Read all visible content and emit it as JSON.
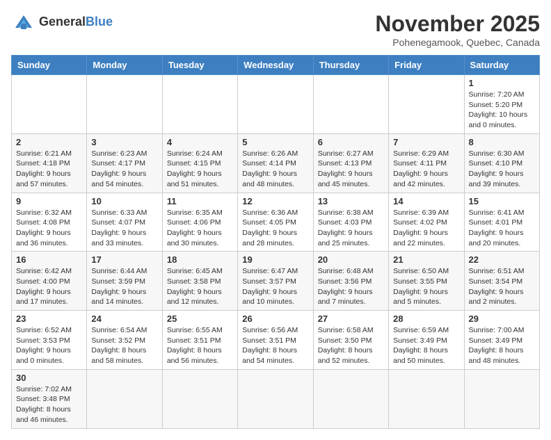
{
  "header": {
    "logo_text_normal": "General",
    "logo_text_bold": "Blue",
    "month_title": "November 2025",
    "location": "Pohenegamook, Quebec, Canada"
  },
  "days_of_week": [
    "Sunday",
    "Monday",
    "Tuesday",
    "Wednesday",
    "Thursday",
    "Friday",
    "Saturday"
  ],
  "weeks": [
    [
      {
        "day": "",
        "info": ""
      },
      {
        "day": "",
        "info": ""
      },
      {
        "day": "",
        "info": ""
      },
      {
        "day": "",
        "info": ""
      },
      {
        "day": "",
        "info": ""
      },
      {
        "day": "",
        "info": ""
      },
      {
        "day": "1",
        "info": "Sunrise: 7:20 AM\nSunset: 5:20 PM\nDaylight: 10 hours and 0 minutes."
      }
    ],
    [
      {
        "day": "2",
        "info": "Sunrise: 6:21 AM\nSunset: 4:18 PM\nDaylight: 9 hours and 57 minutes."
      },
      {
        "day": "3",
        "info": "Sunrise: 6:23 AM\nSunset: 4:17 PM\nDaylight: 9 hours and 54 minutes."
      },
      {
        "day": "4",
        "info": "Sunrise: 6:24 AM\nSunset: 4:15 PM\nDaylight: 9 hours and 51 minutes."
      },
      {
        "day": "5",
        "info": "Sunrise: 6:26 AM\nSunset: 4:14 PM\nDaylight: 9 hours and 48 minutes."
      },
      {
        "day": "6",
        "info": "Sunrise: 6:27 AM\nSunset: 4:13 PM\nDaylight: 9 hours and 45 minutes."
      },
      {
        "day": "7",
        "info": "Sunrise: 6:29 AM\nSunset: 4:11 PM\nDaylight: 9 hours and 42 minutes."
      },
      {
        "day": "8",
        "info": "Sunrise: 6:30 AM\nSunset: 4:10 PM\nDaylight: 9 hours and 39 minutes."
      }
    ],
    [
      {
        "day": "9",
        "info": "Sunrise: 6:32 AM\nSunset: 4:08 PM\nDaylight: 9 hours and 36 minutes."
      },
      {
        "day": "10",
        "info": "Sunrise: 6:33 AM\nSunset: 4:07 PM\nDaylight: 9 hours and 33 minutes."
      },
      {
        "day": "11",
        "info": "Sunrise: 6:35 AM\nSunset: 4:06 PM\nDaylight: 9 hours and 30 minutes."
      },
      {
        "day": "12",
        "info": "Sunrise: 6:36 AM\nSunset: 4:05 PM\nDaylight: 9 hours and 28 minutes."
      },
      {
        "day": "13",
        "info": "Sunrise: 6:38 AM\nSunset: 4:03 PM\nDaylight: 9 hours and 25 minutes."
      },
      {
        "day": "14",
        "info": "Sunrise: 6:39 AM\nSunset: 4:02 PM\nDaylight: 9 hours and 22 minutes."
      },
      {
        "day": "15",
        "info": "Sunrise: 6:41 AM\nSunset: 4:01 PM\nDaylight: 9 hours and 20 minutes."
      }
    ],
    [
      {
        "day": "16",
        "info": "Sunrise: 6:42 AM\nSunset: 4:00 PM\nDaylight: 9 hours and 17 minutes."
      },
      {
        "day": "17",
        "info": "Sunrise: 6:44 AM\nSunset: 3:59 PM\nDaylight: 9 hours and 14 minutes."
      },
      {
        "day": "18",
        "info": "Sunrise: 6:45 AM\nSunset: 3:58 PM\nDaylight: 9 hours and 12 minutes."
      },
      {
        "day": "19",
        "info": "Sunrise: 6:47 AM\nSunset: 3:57 PM\nDaylight: 9 hours and 10 minutes."
      },
      {
        "day": "20",
        "info": "Sunrise: 6:48 AM\nSunset: 3:56 PM\nDaylight: 9 hours and 7 minutes."
      },
      {
        "day": "21",
        "info": "Sunrise: 6:50 AM\nSunset: 3:55 PM\nDaylight: 9 hours and 5 minutes."
      },
      {
        "day": "22",
        "info": "Sunrise: 6:51 AM\nSunset: 3:54 PM\nDaylight: 9 hours and 2 minutes."
      }
    ],
    [
      {
        "day": "23",
        "info": "Sunrise: 6:52 AM\nSunset: 3:53 PM\nDaylight: 9 hours and 0 minutes."
      },
      {
        "day": "24",
        "info": "Sunrise: 6:54 AM\nSunset: 3:52 PM\nDaylight: 8 hours and 58 minutes."
      },
      {
        "day": "25",
        "info": "Sunrise: 6:55 AM\nSunset: 3:51 PM\nDaylight: 8 hours and 56 minutes."
      },
      {
        "day": "26",
        "info": "Sunrise: 6:56 AM\nSunset: 3:51 PM\nDaylight: 8 hours and 54 minutes."
      },
      {
        "day": "27",
        "info": "Sunrise: 6:58 AM\nSunset: 3:50 PM\nDaylight: 8 hours and 52 minutes."
      },
      {
        "day": "28",
        "info": "Sunrise: 6:59 AM\nSunset: 3:49 PM\nDaylight: 8 hours and 50 minutes."
      },
      {
        "day": "29",
        "info": "Sunrise: 7:00 AM\nSunset: 3:49 PM\nDaylight: 8 hours and 48 minutes."
      }
    ],
    [
      {
        "day": "30",
        "info": "Sunrise: 7:02 AM\nSunset: 3:48 PM\nDaylight: 8 hours and 46 minutes."
      },
      {
        "day": "",
        "info": ""
      },
      {
        "day": "",
        "info": ""
      },
      {
        "day": "",
        "info": ""
      },
      {
        "day": "",
        "info": ""
      },
      {
        "day": "",
        "info": ""
      },
      {
        "day": "",
        "info": ""
      }
    ]
  ]
}
